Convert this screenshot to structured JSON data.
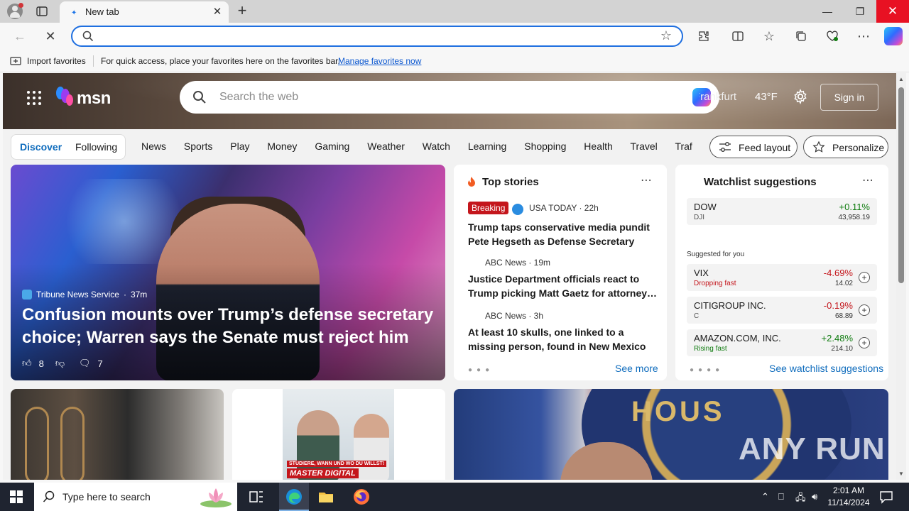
{
  "browser": {
    "tab_title": "New tab",
    "omnibox_value": "",
    "favorites_bar": {
      "import_label": "Import favorites",
      "message": "For quick access, place your favorites here on the favorites bar.",
      "link": "Manage favorites now"
    }
  },
  "msn": {
    "logo_text": "msn",
    "search_placeholder": "Search the web",
    "weather_city": "Frankfurt",
    "weather_temp": "43°F",
    "sign_in": "Sign in",
    "tabs": {
      "discover": "Discover",
      "following": "Following"
    },
    "nav_items": [
      "News",
      "Sports",
      "Play",
      "Money",
      "Gaming",
      "Weather",
      "Watch",
      "Learning",
      "Shopping",
      "Health",
      "Travel",
      "Traf"
    ],
    "feed_layout": "Feed layout",
    "personalize": "Personalize"
  },
  "hero": {
    "source": "Tribune News Service",
    "time": "37m",
    "headline": "Confusion mounts over Trump’s defense secretary choice; Warren says the Senate must reject him",
    "likes": "8",
    "comments": "7"
  },
  "top_stories": {
    "title": "Top stories",
    "breaking": "Breaking",
    "stories": [
      {
        "source": "USA TODAY · 22h",
        "title": "Trump taps conservative media pundit Pete Hegseth as Defense Secretary"
      },
      {
        "source": "ABC News · 19m",
        "title": "Justice Department officials react to Trump picking Matt Gaetz for attorney…"
      },
      {
        "source": "ABC News · 3h",
        "title": "At least 10 skulls, one linked to a missing person, found in New Mexico"
      }
    ],
    "see_more": "See more"
  },
  "watchlist": {
    "title": "Watchlist suggestions",
    "suggested_label": "Suggested for you",
    "see_all": "See watchlist suggestions",
    "rows": [
      {
        "symbol": "DOW",
        "sub": "DJI",
        "change": "+0.11%",
        "price": "43,958.19",
        "dir": "up"
      },
      {
        "symbol": "VIX",
        "sub": "Dropping fast",
        "change": "-4.69%",
        "price": "14.02",
        "dir": "down"
      },
      {
        "symbol": "CITIGROUP INC.",
        "sub": "C",
        "change": "-0.19%",
        "price": "68.89",
        "dir": "down"
      },
      {
        "symbol": "AMAZON.COM, INC.",
        "sub": "Rising fast",
        "change": "+2.48%",
        "price": "214.10",
        "dir": "up"
      }
    ],
    "colors": {
      "up": "#107c10",
      "down": "#c4161c"
    }
  },
  "ad": {
    "line1": "STUDIERE, WANN UND WO DU WILLST!",
    "line2": "MASTER DIGITAL"
  },
  "card3_seal_text": "HOUS",
  "watermark": "ANY RUN",
  "taskbar": {
    "search_placeholder": "Type here to search",
    "time": "2:01 AM",
    "date": "11/14/2024"
  }
}
